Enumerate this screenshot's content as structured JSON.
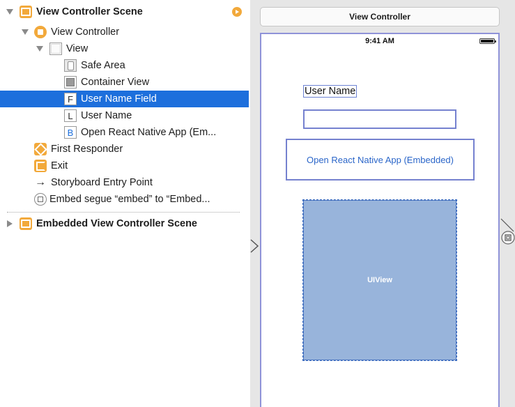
{
  "outline": {
    "rows": [
      {
        "label": "View Controller Scene",
        "icon": "scene-icon",
        "expanded": true
      },
      {
        "label": "View Controller",
        "icon": "view-controller-icon",
        "expanded": true
      },
      {
        "label": "View",
        "icon": "view-icon",
        "expanded": true
      },
      {
        "label": "Safe Area",
        "icon": "safe-area-icon"
      },
      {
        "label": "Container View",
        "icon": "container-view-icon"
      },
      {
        "label": "User Name Field",
        "icon": "text-field-icon",
        "glyph": "F",
        "selected": true
      },
      {
        "label": "User Name",
        "icon": "label-icon",
        "glyph": "L"
      },
      {
        "label": "Open React Native App (Em...",
        "icon": "button-icon",
        "glyph": "B"
      },
      {
        "label": "First Responder",
        "icon": "first-responder-icon"
      },
      {
        "label": "Exit",
        "icon": "exit-icon"
      },
      {
        "label": "Storyboard Entry Point",
        "icon": "arrow-right-icon",
        "glyph": "→"
      },
      {
        "label": "Embed segue “embed” to “Embed...",
        "icon": "segue-icon"
      },
      {
        "label": "Embedded View Controller Scene",
        "icon": "scene-icon",
        "expanded": false
      }
    ],
    "selected_color": "#1d6fdc",
    "scene_icon_color": "#f2a93b"
  },
  "canvas": {
    "title": "View Controller",
    "status_time": "9:41 AM",
    "username_label": "User Name",
    "username_field_value": "",
    "button_label": "Open React Native App (Embedded)",
    "container_label": "UIView",
    "container_color": "#98b4db",
    "button_text_color": "#2b66c9"
  }
}
